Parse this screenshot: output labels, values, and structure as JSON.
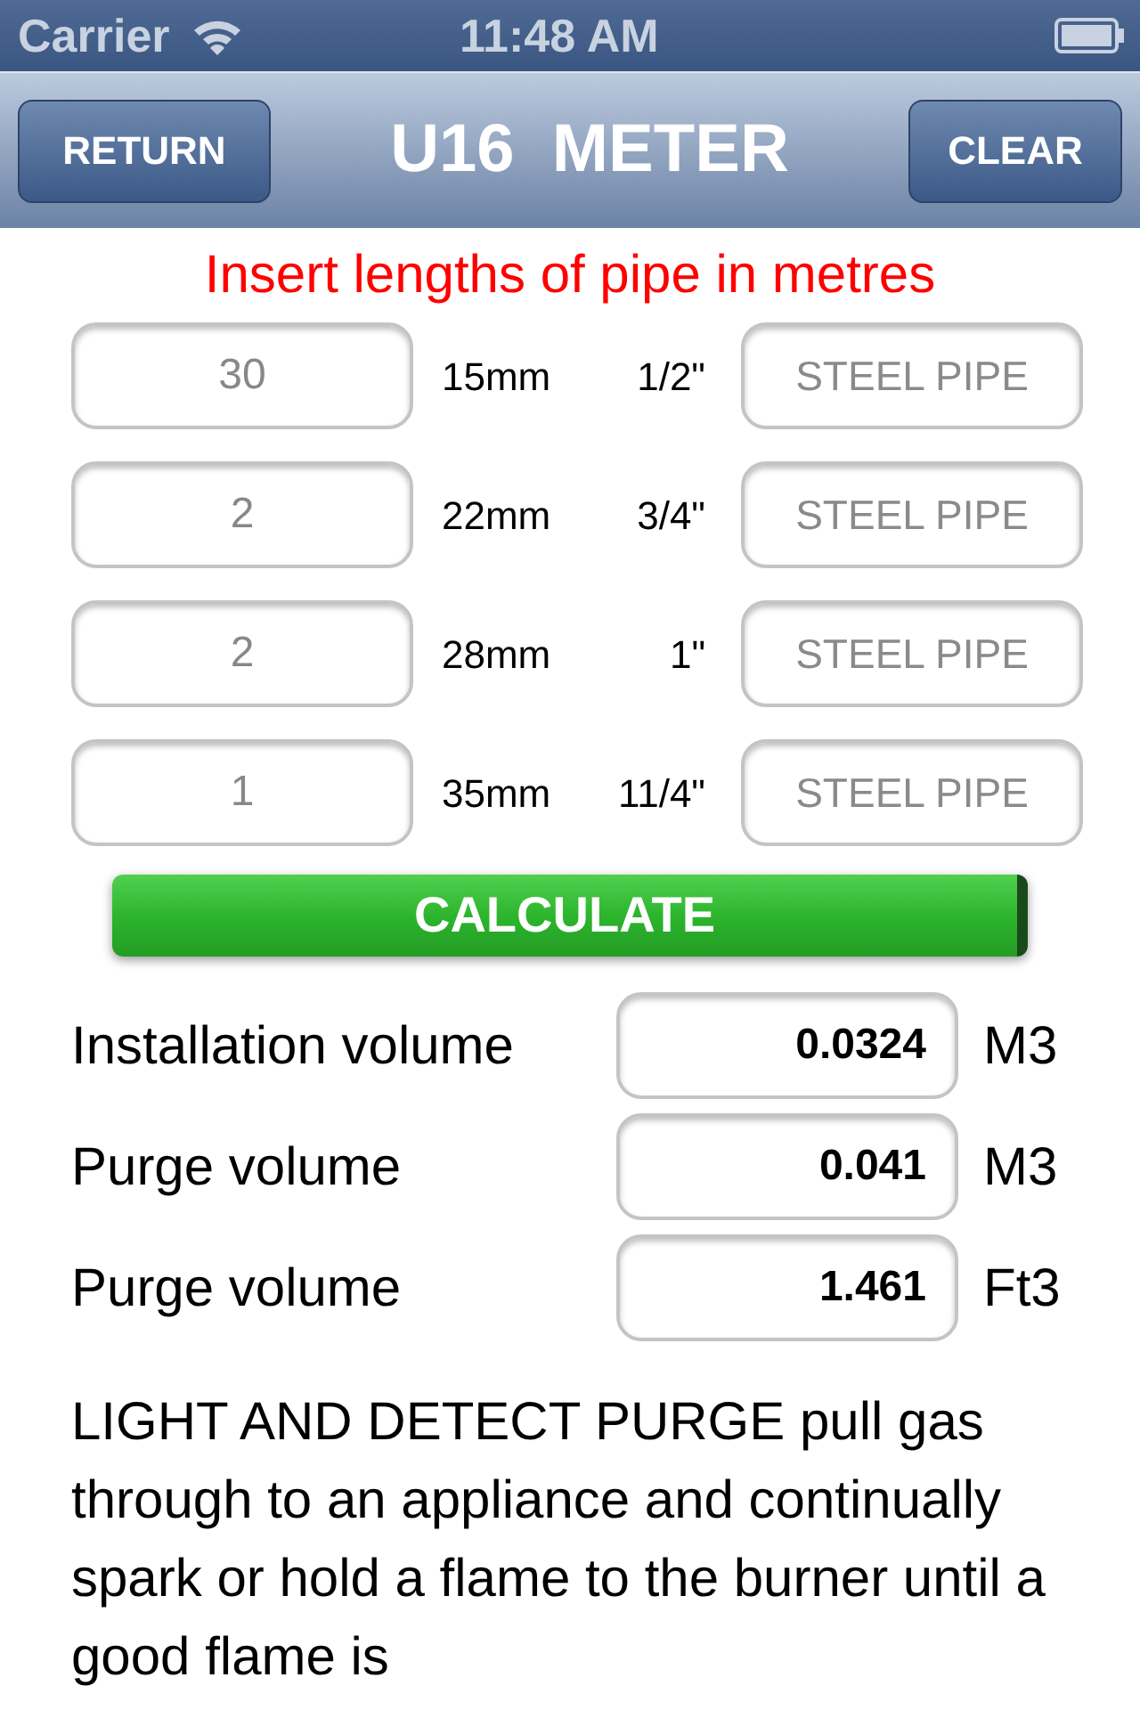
{
  "status_bar": {
    "carrier": "Carrier",
    "time": "11:48 AM"
  },
  "nav_bar": {
    "title": "U16  METER",
    "left_button": "RETURN",
    "right_button": "CLEAR"
  },
  "instruction": "Insert lengths of pipe in metres",
  "pipes": [
    {
      "length": "30",
      "metric": "15mm",
      "imperial": "1/2\"",
      "material_placeholder": "STEEL PIPE"
    },
    {
      "length": "2",
      "metric": "22mm",
      "imperial": "3/4\"",
      "material_placeholder": "STEEL PIPE"
    },
    {
      "length": "2",
      "metric": "28mm",
      "imperial": "1\"",
      "material_placeholder": "STEEL PIPE"
    },
    {
      "length": "1",
      "metric": "35mm",
      "imperial": "11/4\"",
      "material_placeholder": "STEEL PIPE"
    }
  ],
  "calculate_button": "CALCULATE",
  "results": [
    {
      "label": "Installation volume",
      "value": "0.0324",
      "unit": "M3"
    },
    {
      "label": "Purge volume",
      "value": "0.041",
      "unit": "M3"
    },
    {
      "label": "Purge volume",
      "value": "1.461",
      "unit": "Ft3"
    }
  ],
  "note": "LIGHT AND DETECT PURGE pull gas through to an appliance and continually spark or hold a flame to the burner until a good flame is"
}
